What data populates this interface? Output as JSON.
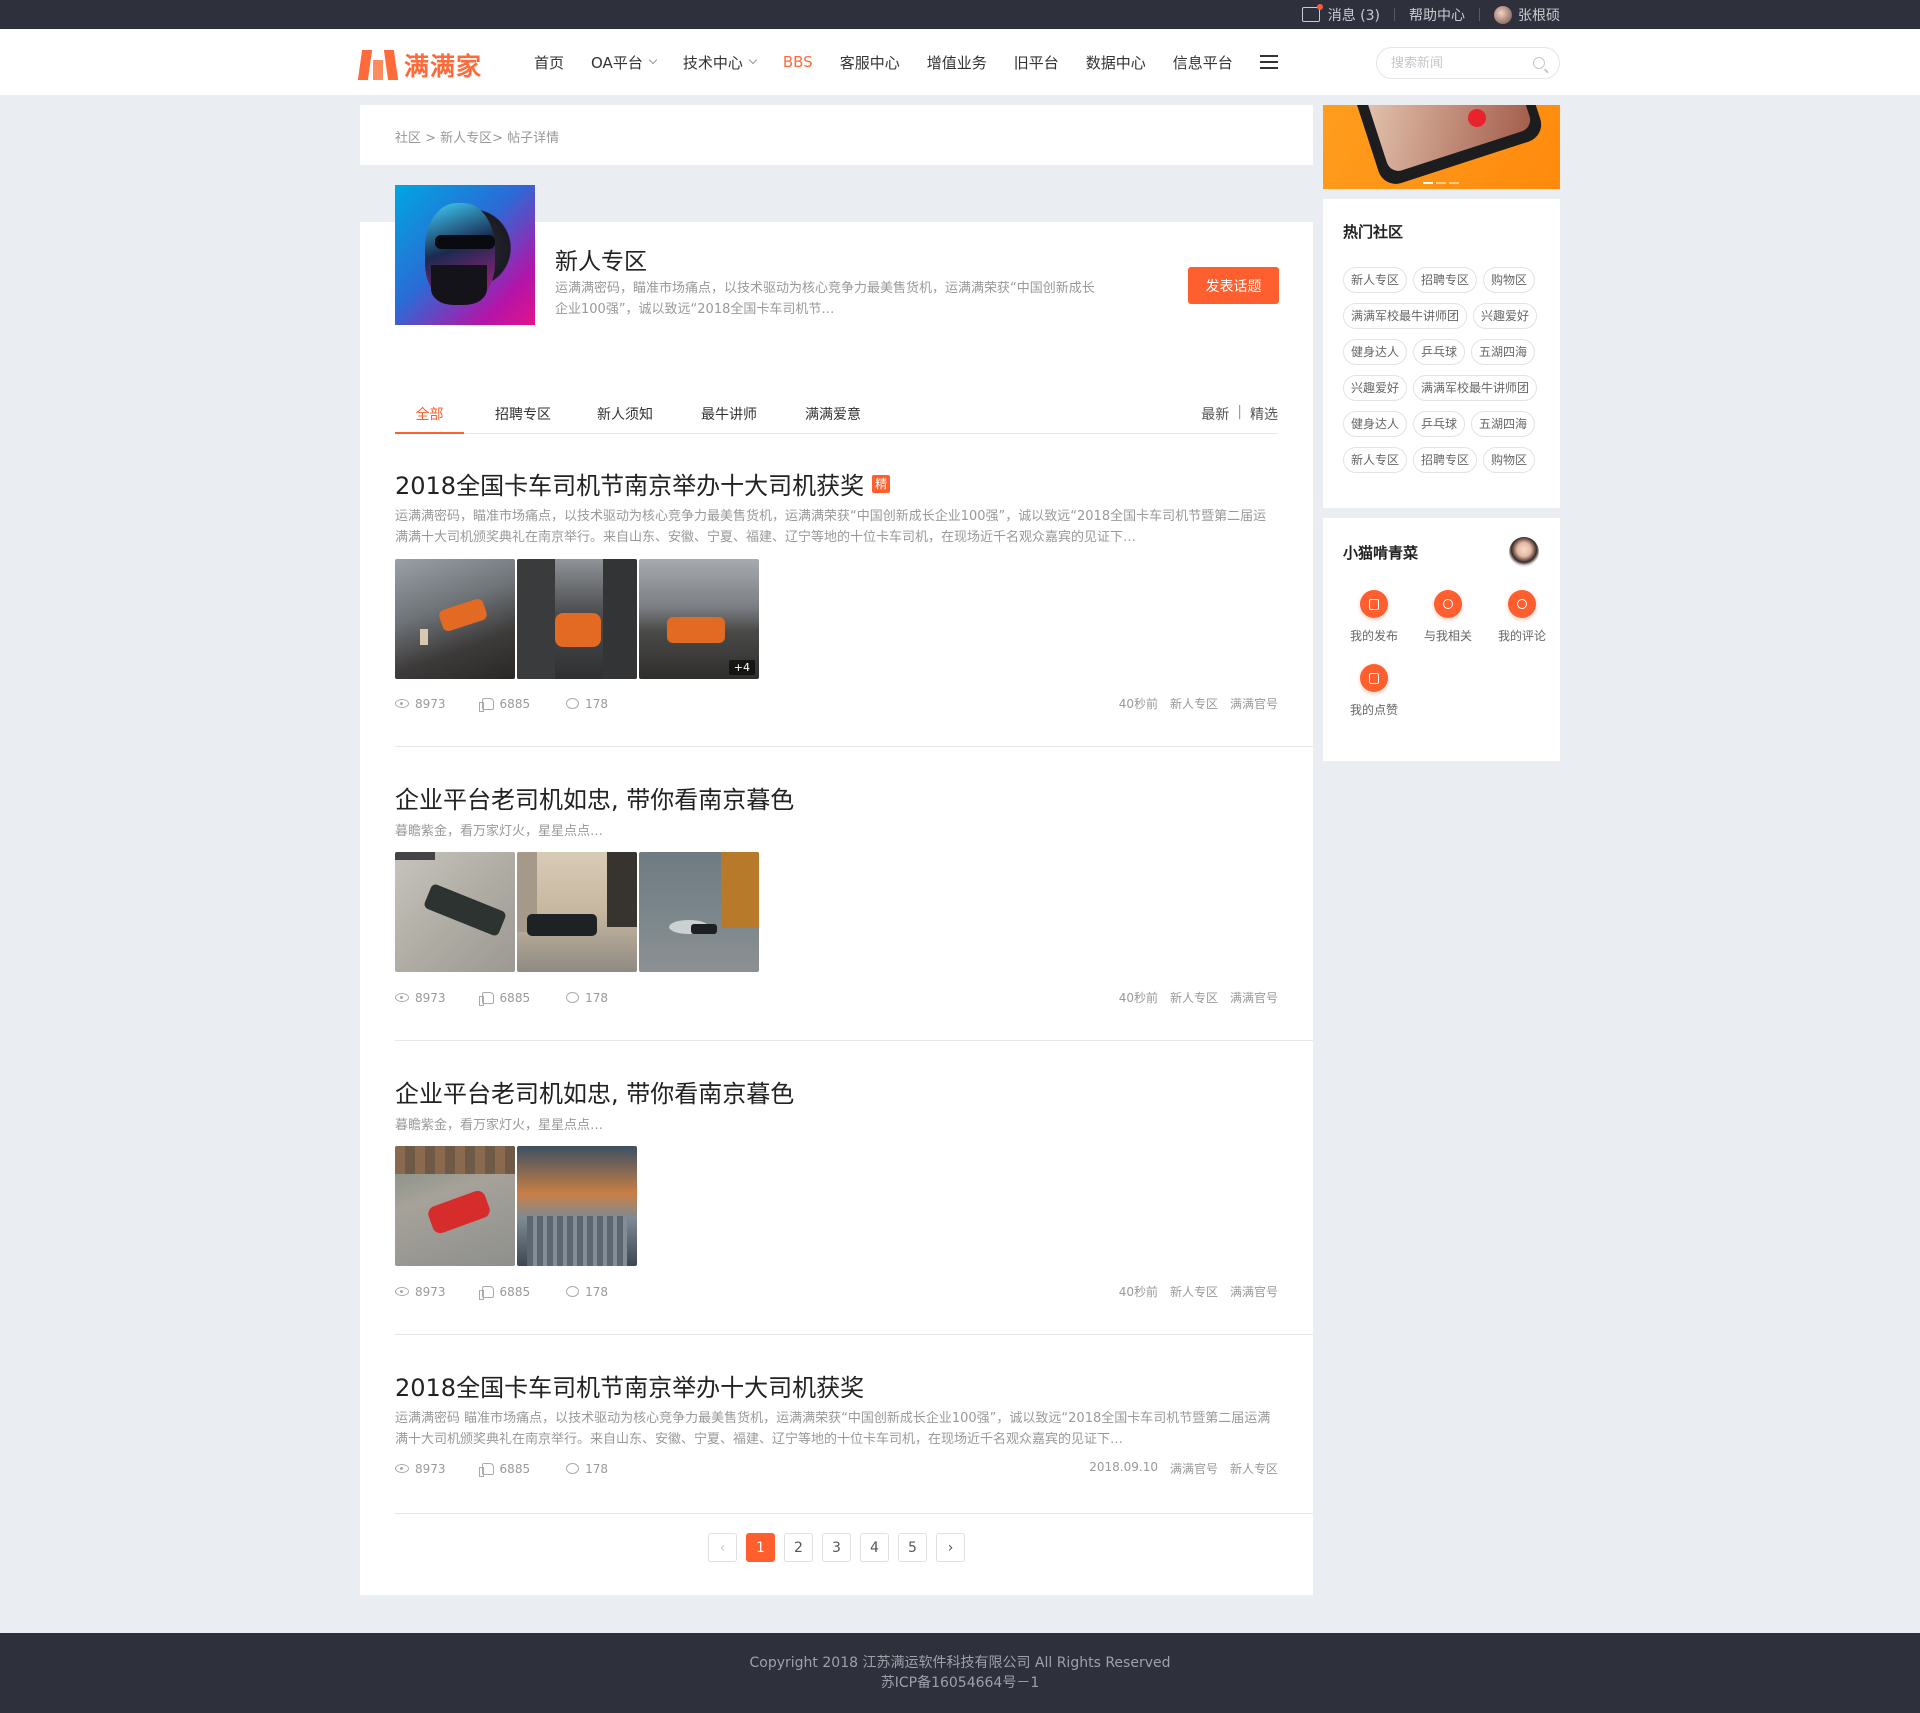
{
  "topbar": {
    "messages": "消息 (3)",
    "help": "帮助中心",
    "user": "张根硕"
  },
  "header": {
    "logo_text": "满满家",
    "nav": [
      {
        "label": "首页",
        "dropdown": false,
        "active": false
      },
      {
        "label": "OA平台",
        "dropdown": true,
        "active": false
      },
      {
        "label": "技术中心",
        "dropdown": true,
        "active": false
      },
      {
        "label": "BBS",
        "dropdown": false,
        "active": true
      },
      {
        "label": "客服中心",
        "dropdown": false,
        "active": false
      },
      {
        "label": "增值业务",
        "dropdown": false,
        "active": false
      },
      {
        "label": "旧平台",
        "dropdown": false,
        "active": false
      },
      {
        "label": "数据中心",
        "dropdown": false,
        "active": false
      },
      {
        "label": "信息平台",
        "dropdown": false,
        "active": false
      }
    ],
    "search_placeholder": "搜索新闻"
  },
  "breadcrumb": "社区 > 新人专区> 帖子详情",
  "zone": {
    "title": "新人专区",
    "desc": "运满满密码，瞄准市场痛点，以技术驱动为核心竞争力最美售货机，运满满荣获“中国创新成长企业100强”，诚以致远“2018全国卡车司机节…",
    "post_button": "发表话题"
  },
  "tabs": [
    "全部",
    "招聘专区",
    "新人须知",
    "最牛讲师",
    "满满爱意"
  ],
  "active_tab": "全部",
  "sort": {
    "latest": "最新",
    "featured": "精选"
  },
  "posts": [
    {
      "title": "2018全国卡车司机节南京举办十大司机获奖",
      "badge": "精",
      "desc": "运满满密码，瞄准市场痛点，以技术驱动为核心竞争力最美售货机，运满满荣获“中国创新成长企业100强”，诚以致远“2018全国卡车司机节暨第二届运满满十大司机颁奖典礼在南京举行。来自山东、安徽、宁夏、福建、辽宁等地的十位卡车司机，在现场近千名观众嘉宾的见证下…",
      "more_images": "+4",
      "views": "8973",
      "likes": "6885",
      "comments": "178",
      "time": "40秒前",
      "category": "新人专区",
      "author": "满满官号"
    },
    {
      "title": "企业平台老司机如忠, 带你看南京暮色",
      "desc": "暮瞻紫金，看万家灯火，星星点点…",
      "views": "8973",
      "likes": "6885",
      "comments": "178",
      "time": "40秒前",
      "category": "新人专区",
      "author": "满满官号"
    },
    {
      "title": "企业平台老司机如忠, 带你看南京暮色",
      "desc": "暮瞻紫金，看万家灯火，星星点点…",
      "views": "8973",
      "likes": "6885",
      "comments": "178",
      "time": "40秒前",
      "category": "新人专区",
      "author": "满满官号"
    },
    {
      "title": "2018全国卡车司机节南京举办十大司机获奖",
      "desc": "运满满密码 瞄准市场痛点，以技术驱动为核心竞争力最美售货机，运满满荣获“中国创新成长企业100强”，诚以致远“2018全国卡车司机节暨第二届运满满十大司机颁奖典礼在南京举行。来自山东、安徽、宁夏、福建、辽宁等地的十位卡车司机，在现场近千名观众嘉宾的见证下…",
      "views": "8973",
      "likes": "6885",
      "comments": "178",
      "time": "2018.09.10",
      "category": "满满官号",
      "author": "新人专区"
    }
  ],
  "pagination": {
    "pages": [
      "1",
      "2",
      "3",
      "4",
      "5"
    ],
    "current": "1"
  },
  "hot": {
    "title": "热门社区",
    "tags": [
      "新人专区",
      "招聘专区",
      "购物区",
      "满满军校最牛讲师团",
      "兴趣爱好",
      "健身达人",
      "乒乓球",
      "五湖四海",
      "兴趣爱好",
      "满满军校最牛讲师团",
      "健身达人",
      "乒乓球",
      "五湖四海",
      "新人专区",
      "招聘专区",
      "购物区"
    ]
  },
  "user_card": {
    "name": "小猫啃青菜",
    "actions": [
      "我的发布",
      "与我相关",
      "我的评论",
      "我的点赞"
    ]
  },
  "footer": {
    "copyright": "Copyright 2018 江苏满运软件科技有限公司 All Rights Reserved",
    "icp": "苏ICP备16054664号－1"
  },
  "colors": {
    "accent": "#ff5e2e",
    "topbar": "#2e313b",
    "background": "#eaedf1"
  }
}
